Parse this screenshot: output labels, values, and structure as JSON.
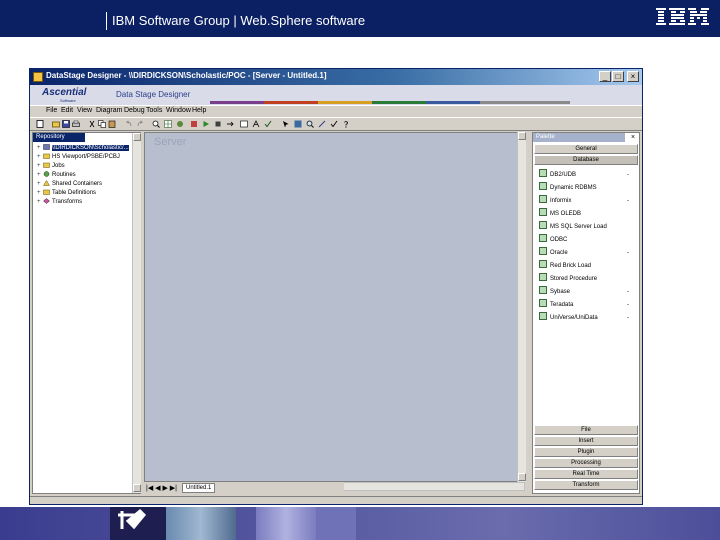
{
  "slide": {
    "header_title": "IBM Software Group | Web.Sphere software",
    "logo_text": "IBM",
    "header_color": "#0b1f63"
  },
  "window": {
    "title": "DataStage Designer - \\\\DIRDICKSON\\Scholastic/POC - [Server - Untitled.1]",
    "buttons": {
      "minimize": "_",
      "maximize": "□",
      "close": "×"
    }
  },
  "brand": {
    "logo": "Ascential",
    "logo_sub": "Software",
    "product": "Data Stage Designer"
  },
  "menu": {
    "items": [
      "File",
      "Edit",
      "View",
      "Diagram",
      "Debug",
      "Tools",
      "Window",
      "Help"
    ]
  },
  "repository": {
    "caption": "Repository Toolbox",
    "items": [
      {
        "label": "\\\\DIRDICKSON\\Scholastic/...",
        "expander": "+",
        "selected": true,
        "icon": "project-icon"
      },
      {
        "label": "HS Viewport/PSBE/PCBJ",
        "expander": "+",
        "selected": false,
        "icon": "folder-icon"
      },
      {
        "label": "Jobs",
        "expander": "+",
        "selected": false,
        "icon": "folder-icon"
      },
      {
        "label": "Routines",
        "expander": "+",
        "selected": false,
        "icon": "routines-icon"
      },
      {
        "label": "Shared Containers",
        "expander": "+",
        "selected": false,
        "icon": "containers-icon"
      },
      {
        "label": "Table Definitions",
        "expander": "+",
        "selected": false,
        "icon": "folder-icon"
      },
      {
        "label": "Transforms",
        "expander": "+",
        "selected": false,
        "icon": "transforms-icon"
      }
    ]
  },
  "canvas": {
    "label": "Server",
    "tab": "Untitled.1",
    "tab_nav": "|◀ ◀ ▶ ▶|"
  },
  "palette": {
    "caption": "Palette",
    "close": "×",
    "groups_top": [
      "General",
      "Database"
    ],
    "stages": [
      {
        "label": "DB2/UDB",
        "arrow": "-"
      },
      {
        "label": "Dynamic RDBMS",
        "arrow": ""
      },
      {
        "label": "Informix",
        "arrow": "-"
      },
      {
        "label": "MS OLEDB",
        "arrow": ""
      },
      {
        "label": "MS SQL Server Load",
        "arrow": ""
      },
      {
        "label": "ODBC",
        "arrow": ""
      },
      {
        "label": "Oracle",
        "arrow": "-"
      },
      {
        "label": "Red Brick Load",
        "arrow": ""
      },
      {
        "label": "Stored Procedure",
        "arrow": ""
      },
      {
        "label": "Sybase",
        "arrow": "-"
      },
      {
        "label": "Teradata",
        "arrow": "-"
      },
      {
        "label": "UniVerse/UniData",
        "arrow": "-"
      }
    ],
    "groups_bottom": [
      "File",
      "Insert",
      "Plugin",
      "Processing",
      "Real Time",
      "Transform"
    ]
  }
}
